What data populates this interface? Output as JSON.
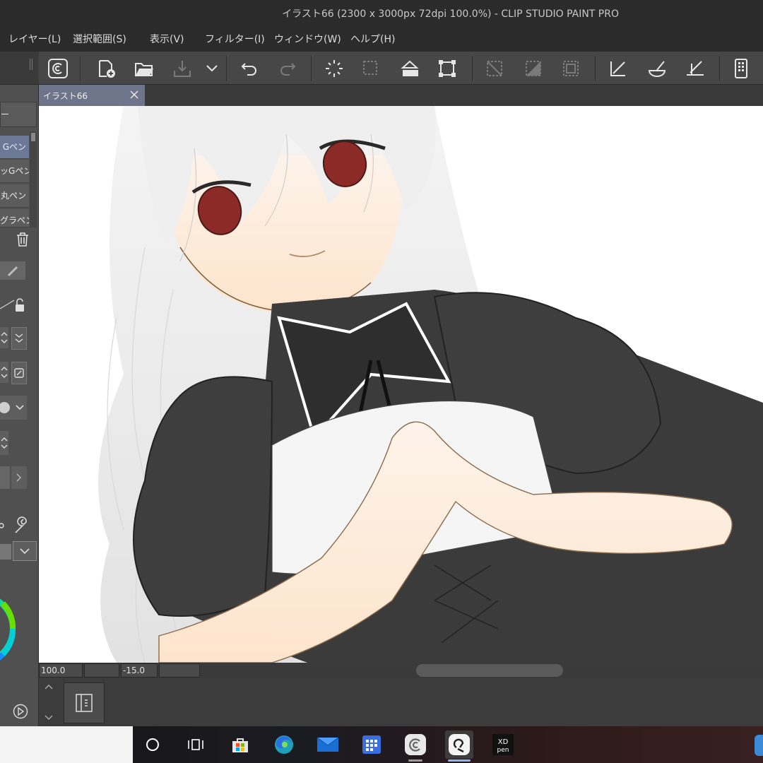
{
  "window": {
    "title": "イラスト66 (2300 x 3000px 72dpi 100.0%)  - CLIP STUDIO PAINT PRO"
  },
  "menu": {
    "items": [
      "レイヤー(L)",
      "選択範囲(S)",
      "表示(V)",
      "フィルター(I)",
      "ウィンドウ(W)",
      "ヘルプ(H)"
    ]
  },
  "toolbar": {
    "icons": [
      "clip-studio-icon",
      "new-file-icon",
      "open-folder-icon",
      "save-icon",
      "chevron-down-icon",
      "undo-icon",
      "redo-icon",
      "clear-icon",
      "deselect-icon",
      "fill-icon",
      "transform-icon",
      "hide-selection-icon",
      "invert-selection-icon",
      "border-selection-icon",
      "ruler-snap-icon",
      "brush-snap-icon",
      "special-ruler-icon",
      "tablet-icon"
    ]
  },
  "subtools": {
    "partial_top": "ー",
    "items": [
      "Gペン",
      "ッGペン",
      "丸ペン",
      "グラペン"
    ]
  },
  "document": {
    "tab_title": "イラスト66"
  },
  "status": {
    "zoom": "100.0",
    "angle": "-15.0"
  },
  "colors": {
    "accent": "#6e7489",
    "selected": "#6b7896",
    "eye": "#8b2a26",
    "dress": "#3b3b3b",
    "skin": "#fde9d6",
    "hair": "#e6e6e6"
  },
  "taskbar": {
    "icons": [
      "cortana-icon",
      "task-view-icon",
      "store-icon",
      "edge-icon",
      "mail-icon",
      "calendar-icon",
      "clip-studio-icon",
      "clip-studio-paint-icon",
      "xp-pen-icon"
    ]
  }
}
